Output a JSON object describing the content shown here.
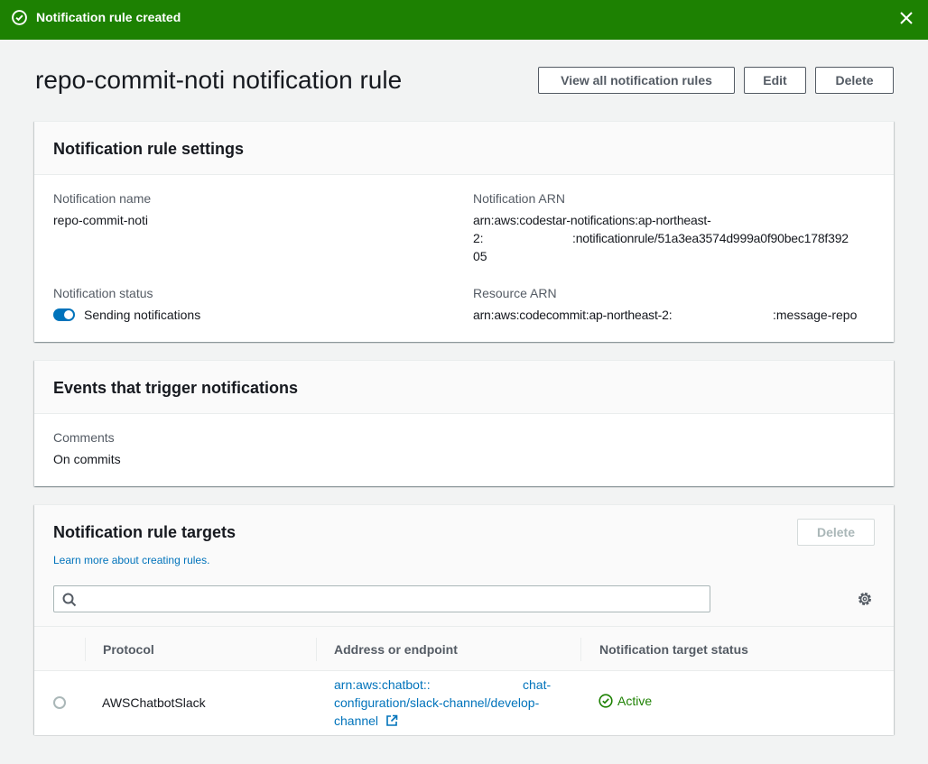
{
  "flash": {
    "message": "Notification rule created",
    "icons": {
      "status": "check-circle-icon",
      "dismiss": "close-icon"
    }
  },
  "header": {
    "title": "repo-commit-noti notification rule",
    "buttons": {
      "view_all": "View all notification rules",
      "edit": "Edit",
      "delete": "Delete"
    }
  },
  "settings": {
    "title": "Notification rule settings",
    "name_label": "Notification name",
    "name_value": "repo-commit-noti",
    "arn_label": "Notification ARN",
    "arn_line1": "arn:aws:codestar-notifications:ap-northeast-",
    "arn_line2_prefix": "2:",
    "arn_line2_suffix": ":notificationrule/51a3ea3574d999a0f90bec178f392",
    "arn_line3": "05",
    "status_label": "Notification status",
    "status_value": "Sending notifications",
    "resource_label": "Resource ARN",
    "resource_prefix": "arn:aws:codecommit:ap-northeast-2:",
    "resource_suffix": ":message-repo"
  },
  "events": {
    "title": "Events that trigger notifications",
    "category_label": "Comments",
    "category_value": "On commits"
  },
  "targets": {
    "title": "Notification rule targets",
    "delete_label": "Delete",
    "learn_more": "Learn more about creating rules.",
    "search_placeholder": "",
    "columns": [
      "Protocol",
      "Address or endpoint",
      "Notification target status"
    ],
    "rows": [
      {
        "protocol": "AWSChatbotSlack",
        "address_line1_prefix": "arn:aws:chatbot::",
        "address_line1_suffix": "chat-",
        "address_line2": "configuration/slack-channel/develop-",
        "address_line3": "channel",
        "status": "Active"
      }
    ]
  },
  "colors": {
    "success": "#1d8102",
    "link": "#0073bb",
    "toggle_on": "#0073bb"
  }
}
